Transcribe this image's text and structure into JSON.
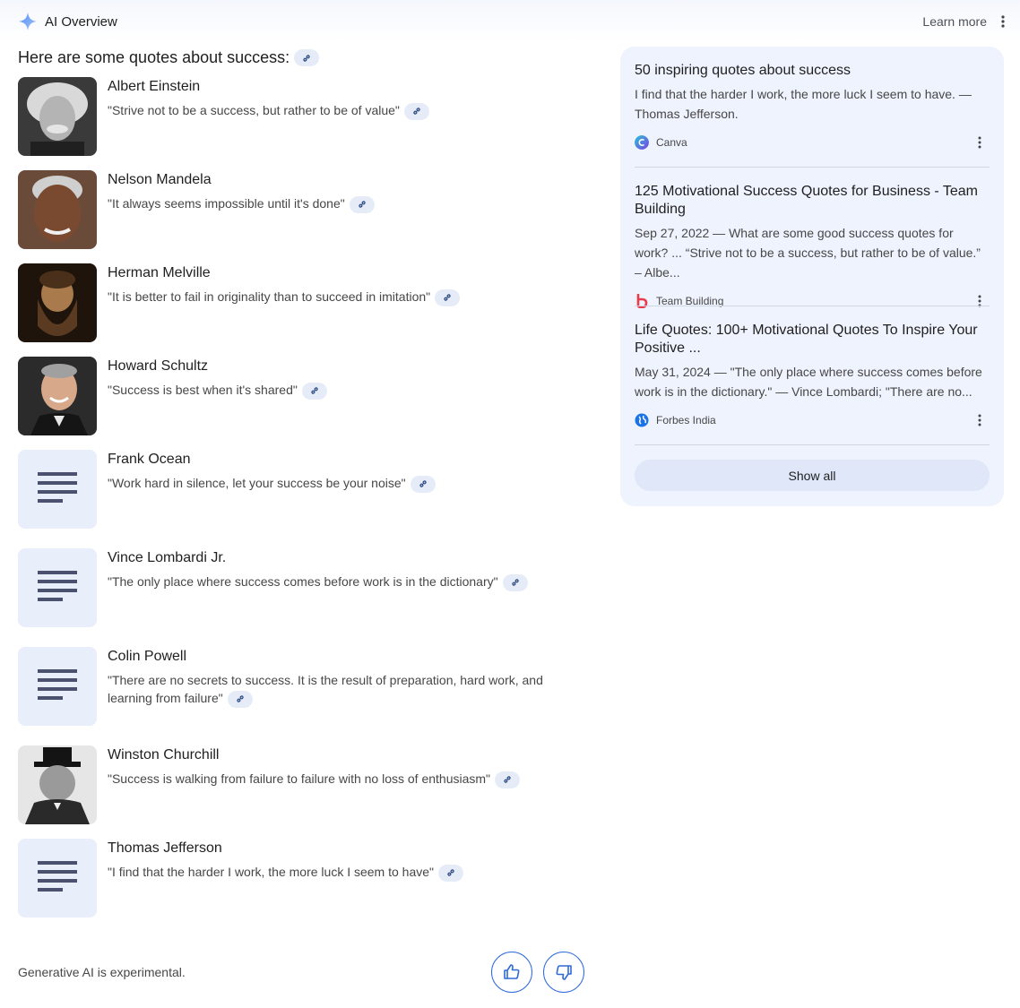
{
  "header": {
    "title": "AI Overview",
    "learn_more": "Learn more",
    "star_icon": "ai-sparkle-icon",
    "menu_icon": "more-vert-icon"
  },
  "intro": "Here are some quotes about success:",
  "quotes": [
    {
      "name": "Albert Einstein",
      "quote": "\"Strive not to be a success, but rather to be of value\"",
      "thumb": "photo"
    },
    {
      "name": "Nelson Mandela",
      "quote": "\"It always seems impossible until it's done\"",
      "thumb": "photo"
    },
    {
      "name": "Herman Melville",
      "quote": "\"It is better to fail in originality than to succeed in imitation\"",
      "thumb": "photo"
    },
    {
      "name": "Howard Schultz",
      "quote": "\"Success is best when it's shared\"",
      "thumb": "photo"
    },
    {
      "name": "Frank Ocean",
      "quote": "\"Work hard in silence, let your success be your noise\"",
      "thumb": "document-icon"
    },
    {
      "name": "Vince Lombardi Jr.",
      "quote": "\"The only place where success comes before work is in the dictionary\"",
      "thumb": "document-icon"
    },
    {
      "name": "Colin Powell",
      "quote": "\"There are no secrets to success. It is the result of preparation, hard work, and learning from failure\"",
      "thumb": "document-icon"
    },
    {
      "name": "Winston Churchill",
      "quote": "\"Success is walking from failure to failure with no loss of enthusiasm\"",
      "thumb": "photo"
    },
    {
      "name": "Thomas Jefferson",
      "quote": "\"I find that the harder I work, the more luck I seem to have\"",
      "thumb": "document-icon"
    }
  ],
  "sources": [
    {
      "title": "50 inspiring quotes about success",
      "snippet": "I find that the harder I work, the more luck I seem to have. — Thomas Jefferson.",
      "site": "Canva"
    },
    {
      "title": "125 Motivational Success Quotes for Business - Team Building",
      "snippet": "Sep 27, 2022 — What are some good success quotes for work? ... “Strive not to be a success, but rather to be of value.” – Albe...",
      "site": "Team Building"
    },
    {
      "title": "Life Quotes: 100+ Motivational Quotes To Inspire Your Positive ...",
      "snippet": "May 31, 2024 — \"The only place where success comes before work is in the dictionary.\" — Vince Lombardi; \"There are no...",
      "site": "Forbes India"
    }
  ],
  "show_all": "Show all",
  "footer": {
    "disclaimer": "Generative AI is experimental.",
    "thumbs_up_icon": "thumbs-up-icon",
    "thumbs_down_icon": "thumbs-down-icon"
  },
  "colors": {
    "accent": "#2f6ad9",
    "panel_bg": "#eef3fd",
    "chip_bg": "#e6ecf7",
    "doc_tile_bg": "#e8eefa"
  }
}
